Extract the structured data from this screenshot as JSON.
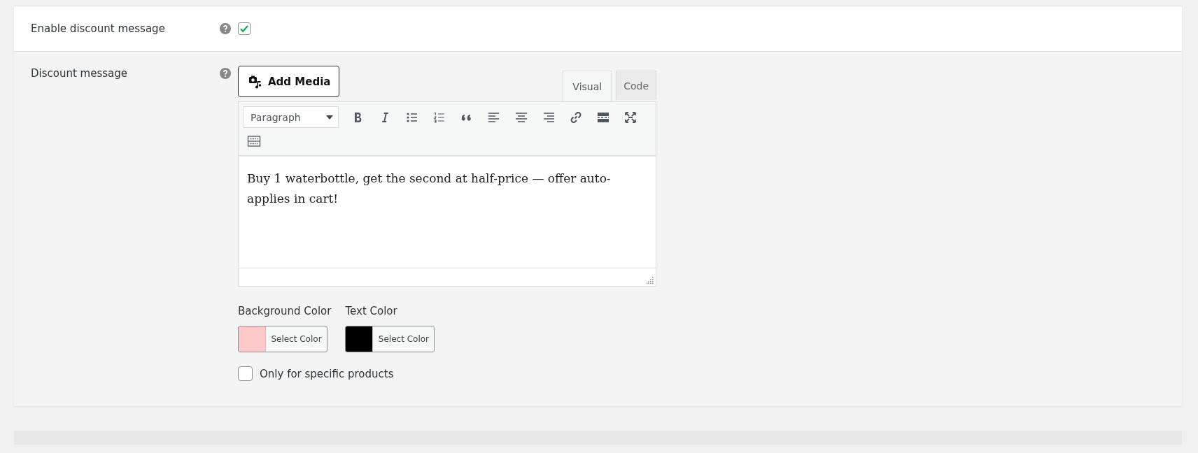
{
  "enable_row": {
    "label": "Enable discount message",
    "checked": true
  },
  "message_row": {
    "label": "Discount message",
    "add_media": "Add Media",
    "tabs": [
      {
        "label": "Visual",
        "selected": true
      },
      {
        "label": "Code",
        "selected": false
      }
    ],
    "format_select": "Paragraph",
    "toolbar": [
      {
        "kind": "bold"
      },
      {
        "kind": "italic"
      },
      {
        "kind": "bullet-list"
      },
      {
        "kind": "numbered-list"
      },
      {
        "kind": "quote"
      },
      {
        "kind": "align-left"
      },
      {
        "kind": "align-center"
      },
      {
        "kind": "align-right"
      },
      {
        "kind": "link"
      },
      {
        "kind": "read-more"
      },
      {
        "kind": "fullscreen"
      },
      {
        "kind": "keyboard"
      }
    ],
    "content": "Buy 1 waterbottle, get the second at half-price — offer auto-applies in cart!",
    "color_pickers": [
      {
        "label": "Background Color",
        "button": "Select Color",
        "color": "#ffc9c9"
      },
      {
        "label": "Text Color",
        "button": "Select Color",
        "color": "#000000"
      }
    ],
    "specific_products": {
      "label": "Only for specific products",
      "checked": false
    }
  }
}
